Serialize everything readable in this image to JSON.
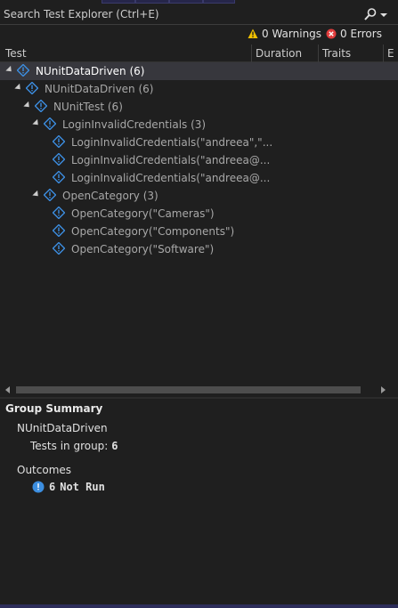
{
  "search": {
    "placeholder": "Search Test Explorer (Ctrl+E)",
    "value": ""
  },
  "toolbar": {
    "warnings_label": "0 Warnings",
    "errors_label": "0 Errors",
    "warning_color": "#f0c000",
    "error_color": "#e03c3c"
  },
  "columns": {
    "test": "Test",
    "duration": "Duration",
    "traits": "Traits",
    "extra": "E"
  },
  "tree": {
    "root": {
      "name": "NUnitDataDriven",
      "count": "(6)"
    },
    "project": {
      "name": "NUnitDataDriven",
      "count": "(6)"
    },
    "namespace": {
      "name": "NUnitTest",
      "count": "(6)"
    },
    "group_login": {
      "name": "LoginInvalidCredentials",
      "count": "(3)"
    },
    "login_tests": [
      "LoginInvalidCredentials(\"andreea\",\"...",
      "LoginInvalidCredentials(\"andreea@...",
      "LoginInvalidCredentials(\"andreea@..."
    ],
    "group_category": {
      "name": "OpenCategory",
      "count": "(3)"
    },
    "category_tests": [
      "OpenCategory(\"Cameras\")",
      "OpenCategory(\"Components\")",
      "OpenCategory(\"Software\")"
    ]
  },
  "summary": {
    "title": "Group Summary",
    "group_name": "NUnitDataDriven",
    "tests_in_group_label": "Tests in group:",
    "tests_in_group_value": "6",
    "outcomes_label": "Outcomes",
    "outcome_count": "6",
    "outcome_state": "Not Run"
  },
  "colors": {
    "not_run_icon": "#3c8ee0",
    "selected_row": "#37373d"
  },
  "icons": {
    "search": "search-icon",
    "not_run": "not-run-icon",
    "warning": "warning-icon",
    "error": "error-icon"
  }
}
